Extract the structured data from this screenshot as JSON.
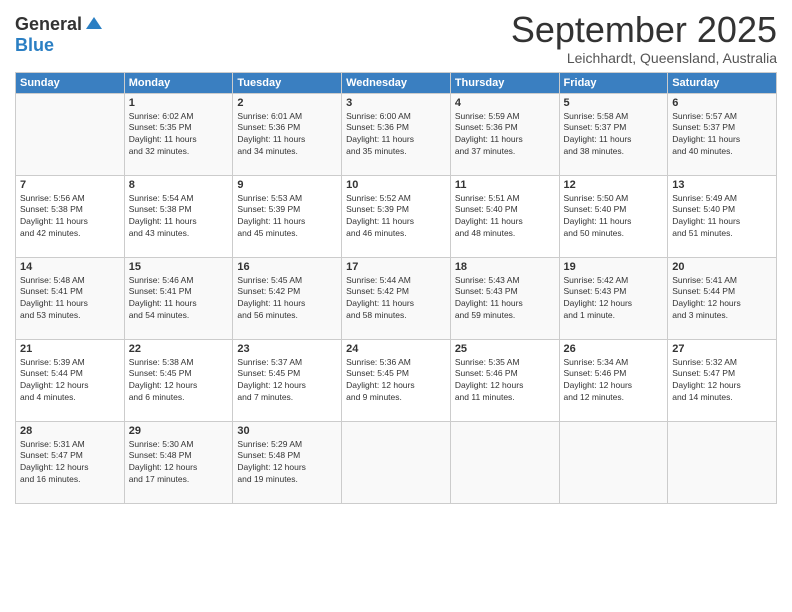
{
  "logo": {
    "general": "General",
    "blue": "Blue"
  },
  "title": "September 2025",
  "location": "Leichhardt, Queensland, Australia",
  "days_header": [
    "Sunday",
    "Monday",
    "Tuesday",
    "Wednesday",
    "Thursday",
    "Friday",
    "Saturday"
  ],
  "weeks": [
    [
      {
        "day": "",
        "info": ""
      },
      {
        "day": "1",
        "info": "Sunrise: 6:02 AM\nSunset: 5:35 PM\nDaylight: 11 hours\nand 32 minutes."
      },
      {
        "day": "2",
        "info": "Sunrise: 6:01 AM\nSunset: 5:36 PM\nDaylight: 11 hours\nand 34 minutes."
      },
      {
        "day": "3",
        "info": "Sunrise: 6:00 AM\nSunset: 5:36 PM\nDaylight: 11 hours\nand 35 minutes."
      },
      {
        "day": "4",
        "info": "Sunrise: 5:59 AM\nSunset: 5:36 PM\nDaylight: 11 hours\nand 37 minutes."
      },
      {
        "day": "5",
        "info": "Sunrise: 5:58 AM\nSunset: 5:37 PM\nDaylight: 11 hours\nand 38 minutes."
      },
      {
        "day": "6",
        "info": "Sunrise: 5:57 AM\nSunset: 5:37 PM\nDaylight: 11 hours\nand 40 minutes."
      }
    ],
    [
      {
        "day": "7",
        "info": "Sunrise: 5:56 AM\nSunset: 5:38 PM\nDaylight: 11 hours\nand 42 minutes."
      },
      {
        "day": "8",
        "info": "Sunrise: 5:54 AM\nSunset: 5:38 PM\nDaylight: 11 hours\nand 43 minutes."
      },
      {
        "day": "9",
        "info": "Sunrise: 5:53 AM\nSunset: 5:39 PM\nDaylight: 11 hours\nand 45 minutes."
      },
      {
        "day": "10",
        "info": "Sunrise: 5:52 AM\nSunset: 5:39 PM\nDaylight: 11 hours\nand 46 minutes."
      },
      {
        "day": "11",
        "info": "Sunrise: 5:51 AM\nSunset: 5:40 PM\nDaylight: 11 hours\nand 48 minutes."
      },
      {
        "day": "12",
        "info": "Sunrise: 5:50 AM\nSunset: 5:40 PM\nDaylight: 11 hours\nand 50 minutes."
      },
      {
        "day": "13",
        "info": "Sunrise: 5:49 AM\nSunset: 5:40 PM\nDaylight: 11 hours\nand 51 minutes."
      }
    ],
    [
      {
        "day": "14",
        "info": "Sunrise: 5:48 AM\nSunset: 5:41 PM\nDaylight: 11 hours\nand 53 minutes."
      },
      {
        "day": "15",
        "info": "Sunrise: 5:46 AM\nSunset: 5:41 PM\nDaylight: 11 hours\nand 54 minutes."
      },
      {
        "day": "16",
        "info": "Sunrise: 5:45 AM\nSunset: 5:42 PM\nDaylight: 11 hours\nand 56 minutes."
      },
      {
        "day": "17",
        "info": "Sunrise: 5:44 AM\nSunset: 5:42 PM\nDaylight: 11 hours\nand 58 minutes."
      },
      {
        "day": "18",
        "info": "Sunrise: 5:43 AM\nSunset: 5:43 PM\nDaylight: 11 hours\nand 59 minutes."
      },
      {
        "day": "19",
        "info": "Sunrise: 5:42 AM\nSunset: 5:43 PM\nDaylight: 12 hours\nand 1 minute."
      },
      {
        "day": "20",
        "info": "Sunrise: 5:41 AM\nSunset: 5:44 PM\nDaylight: 12 hours\nand 3 minutes."
      }
    ],
    [
      {
        "day": "21",
        "info": "Sunrise: 5:39 AM\nSunset: 5:44 PM\nDaylight: 12 hours\nand 4 minutes."
      },
      {
        "day": "22",
        "info": "Sunrise: 5:38 AM\nSunset: 5:45 PM\nDaylight: 12 hours\nand 6 minutes."
      },
      {
        "day": "23",
        "info": "Sunrise: 5:37 AM\nSunset: 5:45 PM\nDaylight: 12 hours\nand 7 minutes."
      },
      {
        "day": "24",
        "info": "Sunrise: 5:36 AM\nSunset: 5:45 PM\nDaylight: 12 hours\nand 9 minutes."
      },
      {
        "day": "25",
        "info": "Sunrise: 5:35 AM\nSunset: 5:46 PM\nDaylight: 12 hours\nand 11 minutes."
      },
      {
        "day": "26",
        "info": "Sunrise: 5:34 AM\nSunset: 5:46 PM\nDaylight: 12 hours\nand 12 minutes."
      },
      {
        "day": "27",
        "info": "Sunrise: 5:32 AM\nSunset: 5:47 PM\nDaylight: 12 hours\nand 14 minutes."
      }
    ],
    [
      {
        "day": "28",
        "info": "Sunrise: 5:31 AM\nSunset: 5:47 PM\nDaylight: 12 hours\nand 16 minutes."
      },
      {
        "day": "29",
        "info": "Sunrise: 5:30 AM\nSunset: 5:48 PM\nDaylight: 12 hours\nand 17 minutes."
      },
      {
        "day": "30",
        "info": "Sunrise: 5:29 AM\nSunset: 5:48 PM\nDaylight: 12 hours\nand 19 minutes."
      },
      {
        "day": "",
        "info": ""
      },
      {
        "day": "",
        "info": ""
      },
      {
        "day": "",
        "info": ""
      },
      {
        "day": "",
        "info": ""
      }
    ]
  ]
}
